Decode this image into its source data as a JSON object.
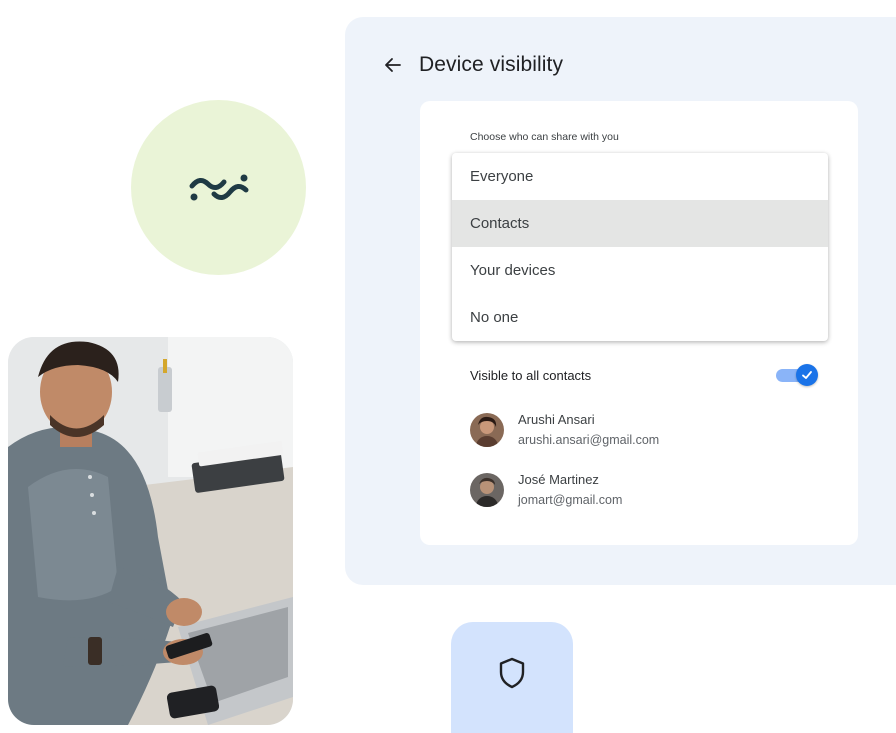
{
  "panel": {
    "title": "Device visibility"
  },
  "sharing": {
    "choose_label": "Choose who can share with you",
    "options": [
      {
        "label": "Everyone",
        "selected": false
      },
      {
        "label": "Contacts",
        "selected": true
      },
      {
        "label": "Your devices",
        "selected": false
      },
      {
        "label": "No one",
        "selected": false
      }
    ]
  },
  "visibility": {
    "label": "Visible to all contacts",
    "enabled": true
  },
  "contacts": [
    {
      "name": "Arushi Ansari",
      "email": "arushi.ansari@gmail.com"
    },
    {
      "name": "José Martinez",
      "email": "jomart@gmail.com"
    }
  ],
  "icons": {
    "back": "back-arrow-icon",
    "logo": "quick-share-logo-icon",
    "check": "check-icon",
    "shield": "shield-icon"
  },
  "colors": {
    "logo_circle": "#eaf4d7",
    "panel_bg": "#eef3fa",
    "selected_option": "#e4e5e4",
    "toggle_accent": "#1a73e8",
    "shield_tile": "#d3e3fd",
    "logo_ink": "#1f3a44"
  }
}
